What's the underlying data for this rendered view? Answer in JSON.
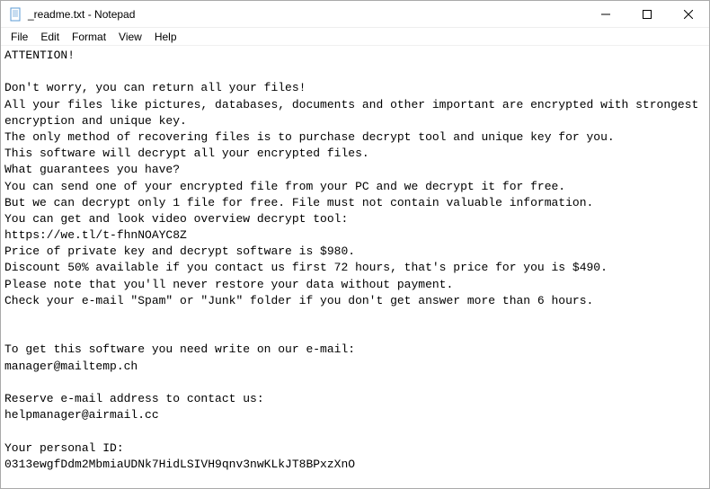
{
  "titlebar": {
    "title": "_readme.txt - Notepad"
  },
  "menu": {
    "file": "File",
    "edit": "Edit",
    "format": "Format",
    "view": "View",
    "help": "Help"
  },
  "content": {
    "text": "ATTENTION!\n\nDon't worry, you can return all your files!\nAll your files like pictures, databases, documents and other important are encrypted with strongest encryption and unique key.\nThe only method of recovering files is to purchase decrypt tool and unique key for you.\nThis software will decrypt all your encrypted files.\nWhat guarantees you have?\nYou can send one of your encrypted file from your PC and we decrypt it for free.\nBut we can decrypt only 1 file for free. File must not contain valuable information.\nYou can get and look video overview decrypt tool:\nhttps://we.tl/t-fhnNOAYC8Z\nPrice of private key and decrypt software is $980.\nDiscount 50% available if you contact us first 72 hours, that's price for you is $490.\nPlease note that you'll never restore your data without payment.\nCheck your e-mail \"Spam\" or \"Junk\" folder if you don't get answer more than 6 hours.\n\n\nTo get this software you need write on our e-mail:\nmanager@mailtemp.ch\n\nReserve e-mail address to contact us:\nhelpmanager@airmail.cc\n\nYour personal ID:\n0313ewgfDdm2MbmiaUDNk7HidLSIVH9qnv3nwKLkJT8BPxzXnO"
  }
}
